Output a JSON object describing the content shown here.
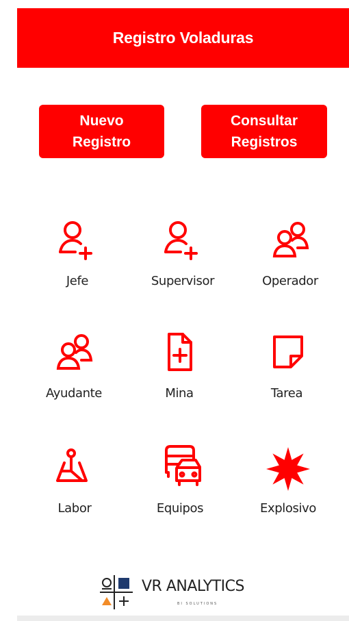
{
  "header": {
    "title": "Registro Voladuras"
  },
  "actions": {
    "new_line1": "Nuevo",
    "new_line2": "Registro",
    "query_line1": "Consultar",
    "query_line2": "Registros"
  },
  "menu": [
    {
      "label": "Jefe",
      "icon": "user-add-icon"
    },
    {
      "label": "Supervisor",
      "icon": "user-add-icon"
    },
    {
      "label": "Operador",
      "icon": "people-icon"
    },
    {
      "label": "Ayudante",
      "icon": "people-icon"
    },
    {
      "label": "Mina",
      "icon": "document-add-icon"
    },
    {
      "label": "Tarea",
      "icon": "note-icon"
    },
    {
      "label": "Labor",
      "icon": "location-map-icon"
    },
    {
      "label": "Equipos",
      "icon": "vehicles-icon"
    },
    {
      "label": "Explosivo",
      "icon": "explosion-icon"
    }
  ],
  "logo": {
    "name": "VR ANALYTICS",
    "tagline": "BI SOLUTIONS"
  },
  "colors": {
    "accent": "#ff0000",
    "logo_navy": "#1f3a6e",
    "logo_orange": "#f28c28"
  }
}
